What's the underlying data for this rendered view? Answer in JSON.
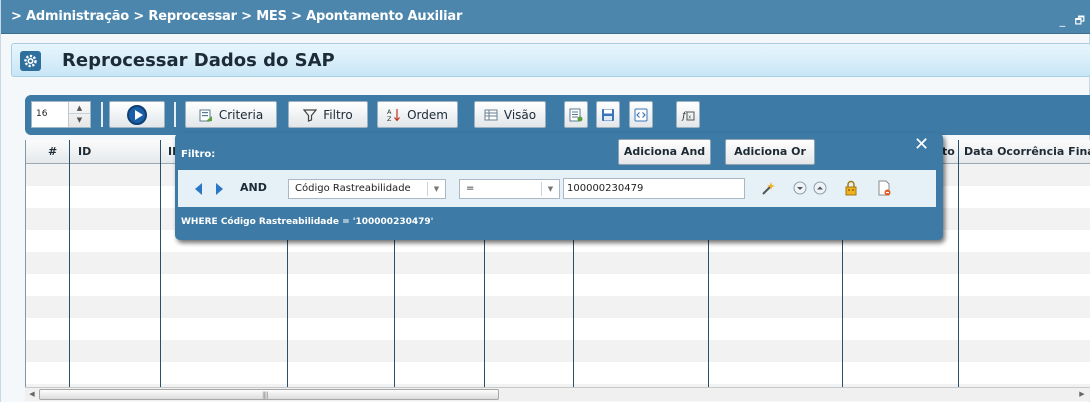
{
  "breadcrumb": "> Administração > Reprocessar > MES > Apontamento Auxiliar",
  "window_controls": {
    "minimize": "_",
    "restore": "🗗"
  },
  "page_title": "Reprocessar Dados do SAP",
  "toolbar": {
    "page_size": "16",
    "criteria_label": "Criteria",
    "filtro_label": "Filtro",
    "ordem_label": "Ordem",
    "visao_label": "Visão"
  },
  "grid": {
    "columns": [
      "#",
      "ID",
      "ID",
      "",
      "",
      "",
      "",
      "",
      "to",
      "Data Ocorrência Final"
    ],
    "row_count": 11
  },
  "filter_popup": {
    "label": "Filtro:",
    "add_and_label": "Adiciona And",
    "add_or_label": "Adiciona Or",
    "close": "✕",
    "operator": "AND",
    "field": "Código Rastreabilidade",
    "comparator": "=",
    "value": "100000230479",
    "where_clause": "WHERE  Código Rastreabilidade = '100000230479'"
  },
  "colors": {
    "header_blue": "#4d86ad",
    "toolbar_blue": "#3d7aa5",
    "title_bg": "#c9e6f6"
  }
}
